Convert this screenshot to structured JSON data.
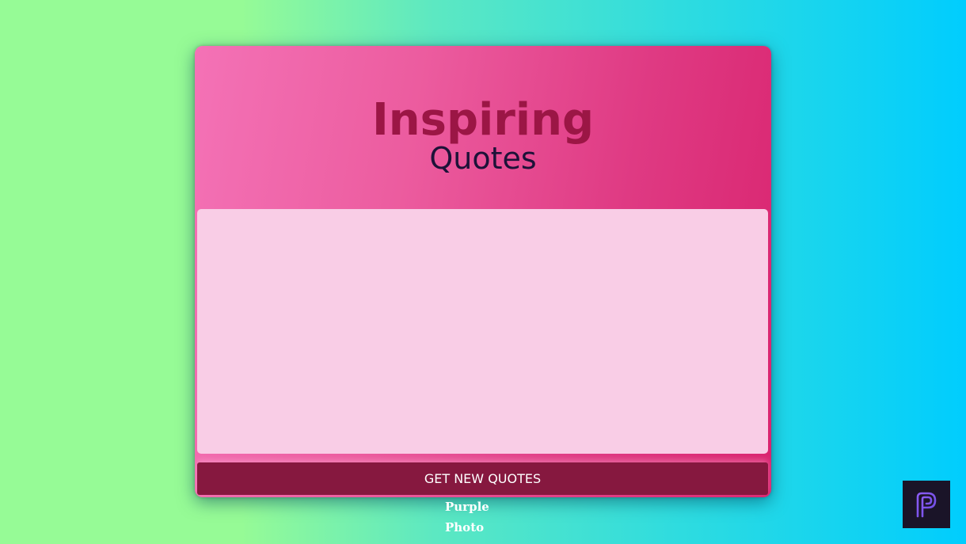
{
  "header": {
    "title_main": "Inspiring",
    "title_sub": "Quotes"
  },
  "quote": {
    "text": ""
  },
  "actions": {
    "new_quote_label": "GET NEW QUOTES"
  },
  "credit": {
    "line1": "Purple",
    "line2": "Photo"
  },
  "badge": {
    "icon": "purple-photo-logo-icon"
  },
  "colors": {
    "title_main": "#9b1645",
    "title_sub": "#1d1238",
    "button_bg": "#86183f",
    "quote_box_bg": "#f9cde6",
    "card_gradient_start": "#f472b6",
    "card_gradient_end": "#d9246f"
  }
}
